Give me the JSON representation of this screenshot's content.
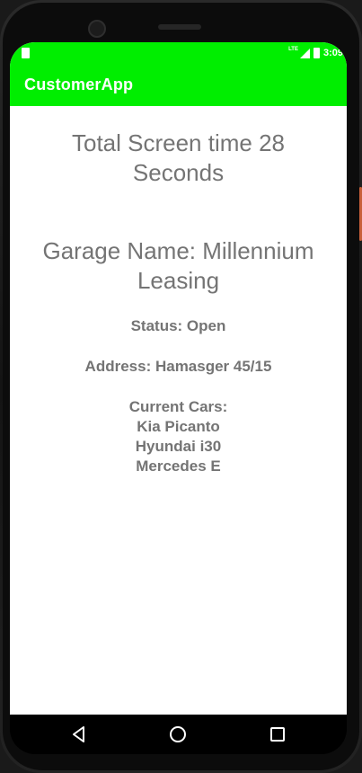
{
  "status_bar": {
    "network_label": "LTE",
    "time": "3:09"
  },
  "app_bar": {
    "title": "CustomerApp"
  },
  "main": {
    "screen_time_line1": "Total Screen time 28",
    "screen_time_line2": "Seconds",
    "garage_line1": "Garage Name: Millennium",
    "garage_line2": "Leasing",
    "status": "Status: Open",
    "address": "Address: Hamasger 45/15",
    "cars_header": "Current Cars:",
    "cars": [
      "Kia Picanto",
      "Hyundai i30",
      "Mercedes E"
    ]
  },
  "nav": {
    "back_icon": "back-triangle-icon",
    "home_icon": "home-circle-icon",
    "recent_icon": "recent-apps-square-icon"
  },
  "colors": {
    "accent": "#00ee00",
    "text": "#747474",
    "background": "#ffffff"
  }
}
